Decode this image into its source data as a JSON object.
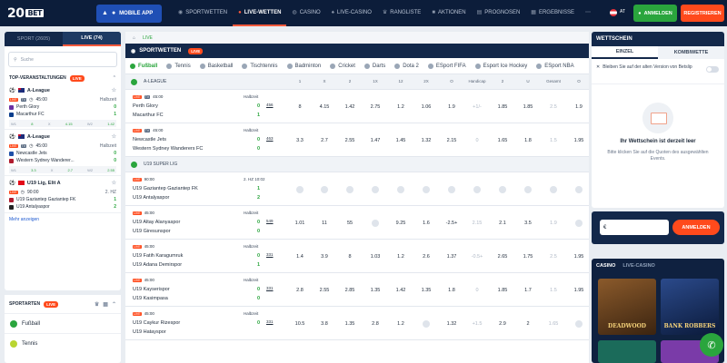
{
  "header": {
    "logo_num": "20",
    "logo_text": "BET",
    "mobile_app": "MOBILE APP",
    "nav": [
      "SPORTWETTEN",
      "LIVE-WETTEN",
      "CASINO",
      "LIVE-CASINO",
      "RANGLISTE",
      "AKTIONEN",
      "PROGNOSEN",
      "ERGEBNISSE"
    ],
    "more": "⋯",
    "lang": "AT",
    "login": "ANMELDEN",
    "register": "REGISTRIEREN"
  },
  "sidebar": {
    "tab_sport": "SPORT (2605)",
    "tab_live": "LIVE (74)",
    "search_placeholder": "Suche",
    "top_events": "TOP-VERANSTALTUNGEN",
    "live": "LIVE",
    "matches": [
      {
        "league": "A-League",
        "time": "45:00",
        "status": "Halbzeit",
        "team1": "Perth Glory",
        "team2": "Macarthur FC",
        "s1": "0",
        "s2": "1",
        "o1": "8",
        "ox": "4.15",
        "o2": "1.42",
        "l1": "W1",
        "lx": "X",
        "l2": "W2"
      },
      {
        "league": "A-League",
        "time": "45:00",
        "status": "Halbzeit",
        "team1": "Newcastle Jets",
        "team2": "Western Sydney Wanderer...",
        "s1": "0",
        "s2": "0",
        "o1": "3.3",
        "ox": "2.7",
        "o2": "2.55",
        "l1": "W1",
        "lx": "X",
        "l2": "W2"
      },
      {
        "league": "U19 Lig, Elit A",
        "time": "90:00",
        "status": "2. HZ",
        "team1": "U19 Gaziantep Gaziantep FK",
        "team2": "U19 Antalyaspor",
        "s1": "1",
        "s2": "2",
        "o1": "",
        "ox": "",
        "o2": "",
        "l1": "W1",
        "lx": "X",
        "l2": "W2"
      }
    ],
    "more_link": "Mehr anzeigen",
    "sportarten": "SPORTARTEN",
    "sports": [
      "Fußball",
      "Tennis"
    ]
  },
  "center": {
    "crumb": "LIVE",
    "head": "SPORTWETTEN",
    "live": "LIVE",
    "tabs": [
      "Fußball",
      "Tennis",
      "Basketball",
      "Tischtennis",
      "Badminton",
      "Cricket",
      "Darts",
      "Dota 2",
      "ESport FIFA",
      "Esport Ice Hockey",
      "ESport NBA"
    ],
    "columns": [
      "1",
      "X",
      "2",
      "1X",
      "12",
      "2X",
      "O",
      "Handicap",
      "2",
      "U",
      "Gesamt",
      "O"
    ],
    "leagues": [
      {
        "name": "A-LEAGUE",
        "matches": [
          {
            "time": "45:00",
            "status": "Halbzeit",
            "t1": "Perth Glory",
            "t2": "Macarthur FC",
            "s1": "0",
            "s2": "1",
            "count": "456",
            "odds": [
              "8",
              "4.15",
              "1.42",
              "2.75",
              "1.2",
              "1.06",
              "1.9",
              "+1/-",
              "1.85",
              "1.85",
              "2.5",
              "1.9"
            ]
          },
          {
            "time": "45:00",
            "status": "Halbzeit",
            "t1": "Newcastle Jets",
            "t2": "Western Sydney Wanderers FC",
            "s1": "0",
            "s2": "0",
            "count": "463",
            "odds": [
              "3.3",
              "2.7",
              "2.55",
              "1.47",
              "1.45",
              "1.32",
              "2.15",
              "0",
              "1.65",
              "1.8",
              "1.5",
              "1.95"
            ]
          }
        ]
      },
      {
        "name": "U19 SUPER LIG",
        "matches": [
          {
            "time": "90:00",
            "status": "2. HZ 10:02",
            "t1": "U19 Gaziantep Gaziantep FK",
            "t2": "U19 Antalyaspor",
            "s1": "1",
            "s2": "2",
            "count": "",
            "odds": [
              "",
              "",
              "",
              "",
              "",
              "",
              "",
              "",
              "",
              "",
              "",
              ""
            ]
          },
          {
            "time": "45:00",
            "status": "Halbzeit",
            "t1": "U19 Altay Alanyaspor",
            "t2": "U19 Giresunspor",
            "s1": "0",
            "s2": "0",
            "count": "549",
            "odds": [
              "1.01",
              "11",
              "55",
              "",
              "9.25",
              "1.6",
              "-2.5+",
              "2.15",
              "2.1",
              "3.5",
              "1.9",
              ""
            ]
          },
          {
            "time": "45:00",
            "status": "Halbzeit",
            "t1": "U19 Fatih Karagumruk",
            "t2": "U19 Adana Demirspor",
            "s1": "0",
            "s2": "1",
            "count": "331",
            "odds": [
              "1.4",
              "3.9",
              "8",
              "1.03",
              "1.2",
              "2.6",
              "1.37",
              "-0.5+",
              "2.65",
              "1.75",
              "2.5",
              "1.95"
            ]
          },
          {
            "time": "45:00",
            "status": "Halbzeit",
            "t1": "U19 Kayserispor",
            "t2": "U19 Kasimpasa",
            "s1": "0",
            "s2": "0",
            "count": "331",
            "odds": [
              "2.8",
              "2.55",
              "2.85",
              "1.35",
              "1.42",
              "1.35",
              "1.8",
              "0",
              "1.85",
              "1.7",
              "1.5",
              "1.95"
            ]
          },
          {
            "time": "45:00",
            "status": "Halbzeit",
            "t1": "U19 Caykur Rizespor",
            "t2": "U19 Hatayspor",
            "s1": "0",
            "s2": "",
            "count": "331",
            "odds": [
              "10.5",
              "3.8",
              "1.35",
              "2.8",
              "1.2",
              "",
              "1.32",
              "+1.5",
              "2.9",
              "2",
              "1.65",
              ""
            ]
          }
        ]
      }
    ]
  },
  "betslip": {
    "title": "WETTSCHEIN",
    "tab_single": "EINZEL",
    "tab_combo": "KOMBIWETTE",
    "old_version": "Bleiben Sie auf der alten Version von Betslip",
    "empty": "Ihr Wettschein ist derzeit leer",
    "desc": "Bitte klicken Sie auf die Quoten des ausgewählten Events.",
    "currency": "€",
    "login": "ANMELDEN"
  },
  "casino": {
    "tab_casino": "CASINO",
    "tab_live": "LIVE-CASINO",
    "games": [
      "DEADWOOD",
      "BANK ROBBERS"
    ]
  },
  "accent_colors": {
    "orange": "#ff4a1c",
    "green": "#2aa53d",
    "navy": "#13284a"
  }
}
